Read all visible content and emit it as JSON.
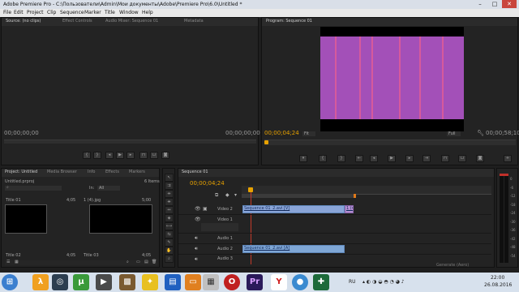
{
  "window": {
    "title": "Adobe Premiere Pro - C:\\Пользователи\\Admin\\Мои документы\\Adobe\\Premiere Pro\\6.0\\Untitled *",
    "minimize": "–",
    "maximize": "□",
    "close": "✕"
  },
  "menu": [
    "File",
    "Edit",
    "Project",
    "Clip",
    "Sequence",
    "Marker",
    "Title",
    "Window",
    "Help"
  ],
  "source_panel": {
    "tabs": [
      "Source: (no clips)",
      "Effect Controls",
      "Audio Mixer: Sequence 01",
      "Metadata"
    ],
    "timecode_left": "00;00;00;00",
    "timecode_right": "00;00;00;00"
  },
  "program_panel": {
    "tab": "Program: Sequence 01",
    "timecode_current": "00;00;04;24",
    "zoom": "Fit",
    "quality": "Full",
    "timecode_duration": "00;00;58;10",
    "preview_colors": {
      "background": "#a350b8",
      "letterbox": "#000000",
      "stripe": "#d65a9c"
    }
  },
  "project_panel": {
    "tabs": [
      "Project: Untitled",
      "Media Browser",
      "Info",
      "Effects",
      "Markers"
    ],
    "project_file": "Untitled.prproj",
    "item_count": "6 Items",
    "in_label": "In:",
    "in_value": "All",
    "items": [
      {
        "name": "Title 01",
        "duration": "4;05"
      },
      {
        "name": "1 (4).jpg",
        "duration": "5;00"
      },
      {
        "name": "Title 02",
        "duration": "4;05"
      },
      {
        "name": "Title 03",
        "duration": "4;05"
      }
    ]
  },
  "timeline": {
    "tab": "Sequence 01",
    "timecode": "00;00;04;24",
    "tracks": [
      {
        "name": "Video 2",
        "clip": "Sequence 01_2.avi [V]",
        "trailing": "1 (4"
      },
      {
        "name": "Video 1",
        "clip": "",
        "trailing": ""
      },
      {
        "name": "Audio 1",
        "clip": "",
        "trailing": ""
      },
      {
        "name": "Audio 2",
        "clip": "Sequence 01_2.avi [A]",
        "trailing": ""
      },
      {
        "name": "Audio 3",
        "clip": "",
        "trailing": ""
      }
    ],
    "status": "Generate (Aero)"
  },
  "audio_meter": {
    "scale": [
      "0",
      "-6",
      "-12",
      "-18",
      "-24",
      "-30",
      "-36",
      "-42",
      "-48",
      "-54"
    ]
  },
  "taskbar": {
    "lang": "RU",
    "time": "22:00",
    "date": "26.08.2016"
  }
}
